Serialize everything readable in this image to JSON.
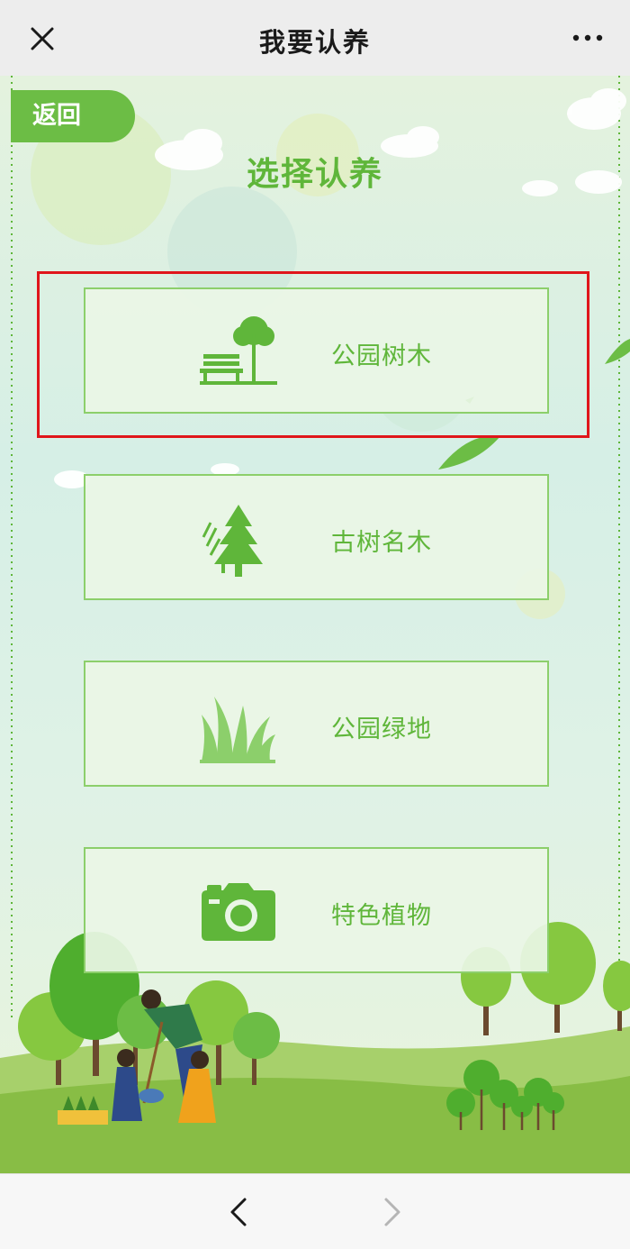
{
  "window": {
    "title": "我要认养"
  },
  "header": {
    "close_icon": "close-icon",
    "more_icon": "more-icon"
  },
  "page": {
    "back_label": "返回",
    "heading": "选择认养"
  },
  "options": [
    {
      "label": "公园树木",
      "icon": "park-tree-bench-icon",
      "highlighted": true
    },
    {
      "label": "古树名木",
      "icon": "ancient-pine-icon",
      "highlighted": false
    },
    {
      "label": "公园绿地",
      "icon": "grass-icon",
      "highlighted": false
    },
    {
      "label": "特色植物",
      "icon": "camera-icon",
      "highlighted": false
    }
  ],
  "footer": {
    "back_icon": "chevron-left-icon",
    "forward_icon": "chevron-right-icon",
    "forward_enabled": false
  },
  "colors": {
    "accent": "#6cbd45",
    "text_green": "#5fb63a",
    "card_border": "#8ccf6b",
    "highlight": "#e0161b"
  }
}
